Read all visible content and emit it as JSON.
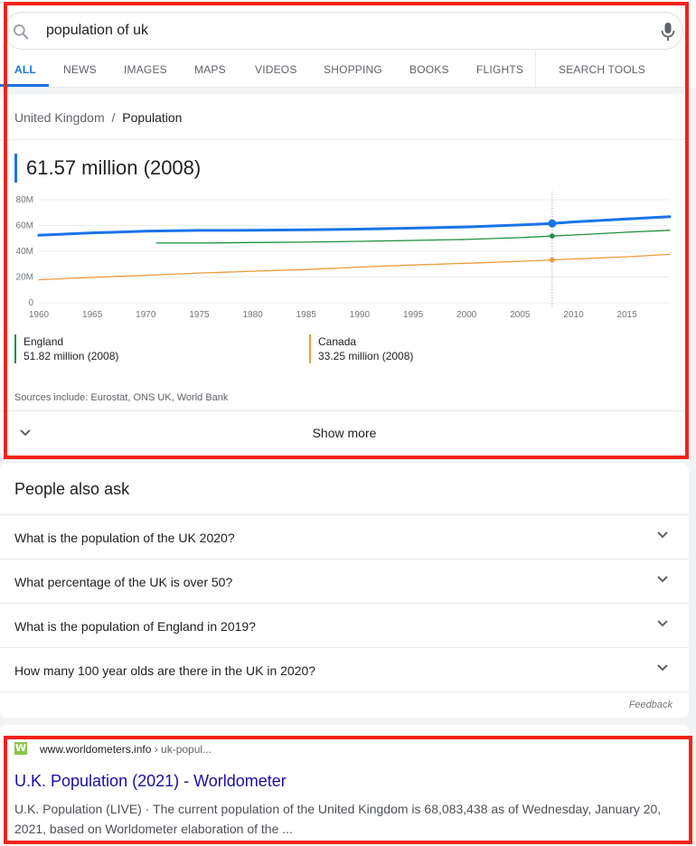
{
  "search": {
    "query": "population of uk",
    "tabs": [
      "ALL",
      "NEWS",
      "IMAGES",
      "MAPS",
      "VIDEOS",
      "SHOPPING",
      "BOOKS",
      "FLIGHTS"
    ],
    "tools_label": "SEARCH TOOLS"
  },
  "knowledge": {
    "breadcrumb_parent": "United Kingdom",
    "breadcrumb_sep": "/",
    "breadcrumb_current": "Population",
    "headline": "61.57 million (2008)",
    "legend": [
      {
        "name": "England",
        "value": "51.82 million (2008)",
        "color": "#1e8e3e"
      },
      {
        "name": "Canada",
        "value": "33.25 million (2008)",
        "color": "#f29a38"
      }
    ],
    "sources": "Sources include: Eurostat, ONS UK, World Bank",
    "show_more": "Show more"
  },
  "chart_data": {
    "type": "line",
    "title": "",
    "xlim": [
      1960,
      2019
    ],
    "ylim": [
      0,
      80
    ],
    "y_ticks": [
      "0",
      "20M",
      "40M",
      "60M",
      "80M"
    ],
    "y_tick_values": [
      0,
      20,
      40,
      60,
      80
    ],
    "x_ticks": [
      1960,
      1965,
      1970,
      1975,
      1980,
      1985,
      1990,
      1995,
      2000,
      2005,
      2010,
      2015
    ],
    "highlight_year": 2008,
    "grid": true,
    "series": [
      {
        "key": "uk",
        "color": "#1a73e8",
        "width": 3,
        "x": [
          1960,
          1965,
          1970,
          1975,
          1980,
          1985,
          1990,
          1995,
          2000,
          2005,
          2008,
          2010,
          2015,
          2019
        ],
        "y": [
          52.4,
          54.3,
          55.6,
          56.2,
          56.3,
          56.6,
          57.2,
          58.0,
          58.9,
          60.4,
          61.57,
          62.8,
          65.1,
          66.8
        ]
      },
      {
        "key": "england",
        "color": "#1e8e3e",
        "width": 1.3,
        "x": [
          1971,
          1975,
          1980,
          1985,
          1990,
          1995,
          2000,
          2005,
          2008,
          2010,
          2015,
          2019
        ],
        "y": [
          46.4,
          46.4,
          46.8,
          47.1,
          47.7,
          48.4,
          49.2,
          50.6,
          51.82,
          52.6,
          54.8,
          56.3
        ]
      },
      {
        "key": "canada",
        "color": "#f29a38",
        "width": 1.3,
        "x": [
          1960,
          1965,
          1970,
          1975,
          1980,
          1985,
          1990,
          1995,
          2000,
          2005,
          2008,
          2010,
          2015,
          2019
        ],
        "y": [
          17.9,
          19.7,
          21.3,
          23.1,
          24.5,
          25.8,
          27.7,
          29.3,
          30.7,
          32.2,
          33.25,
          34.0,
          35.7,
          37.6
        ]
      }
    ]
  },
  "paa": {
    "title": "People also ask",
    "questions": [
      "What is the population of the UK 2020?",
      "What percentage of the UK is over 50?",
      "What is the population of England in 2019?",
      "How many 100 year olds are there in the UK in 2020?"
    ],
    "feedback": "Feedback"
  },
  "result": {
    "favicon_letter": "W",
    "domain": "www.worldometers.info",
    "path": " › uk-popul...",
    "title": "U.K. Population (2021) - Worldometer",
    "snippet": "U.K. Population (LIVE) · The current population of the United Kingdom is 68,083,438 as of Wednesday, January 20, 2021, based on Worldometer elaboration of the ..."
  },
  "colors": {
    "accent": "#1a73e8",
    "highlight_box": "#f1231a",
    "link": "#1a0dab"
  }
}
